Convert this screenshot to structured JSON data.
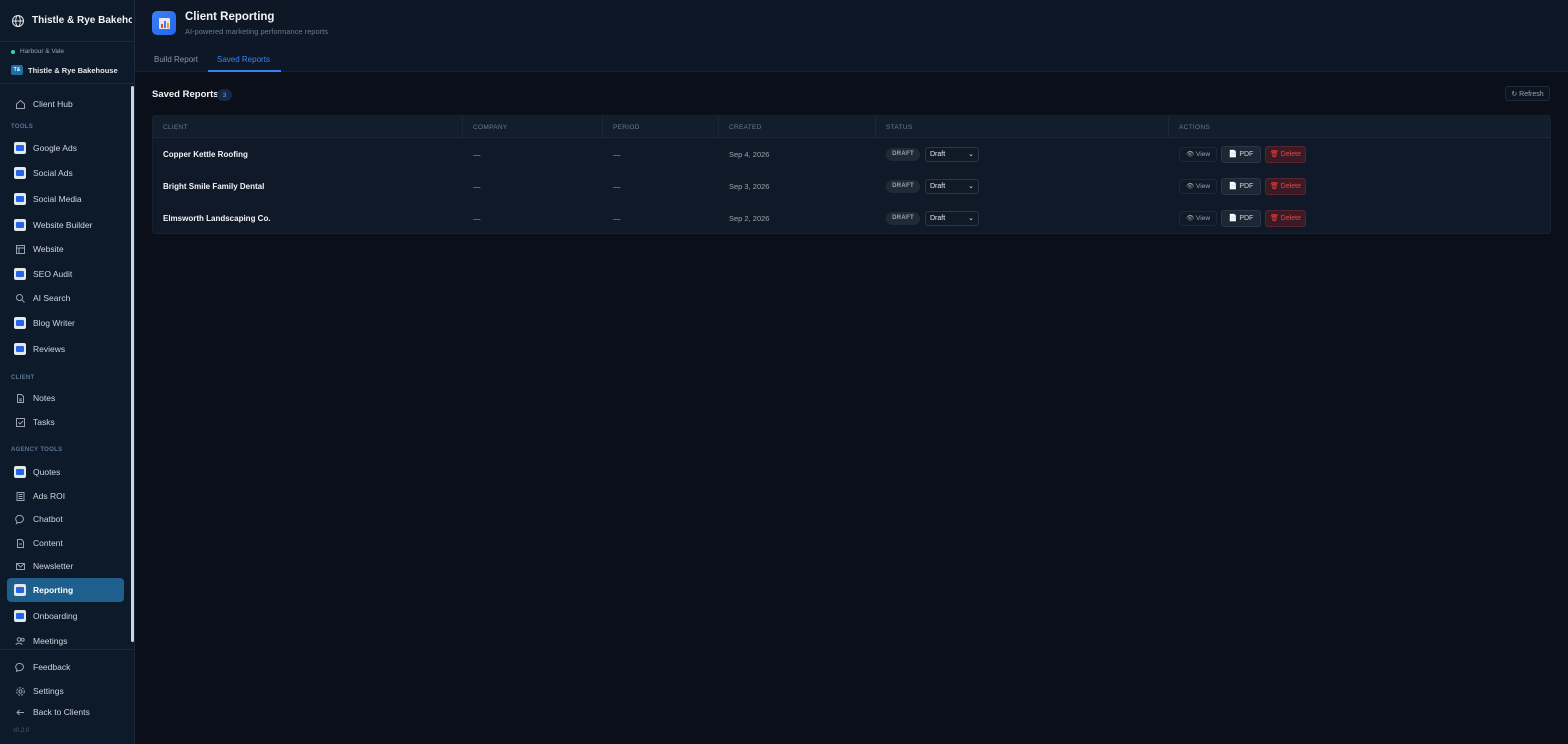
{
  "sidebar": {
    "brand": "Thistle & Rye Bakehouse",
    "agency": "Harbour & Vale",
    "client_initials": "T&",
    "client_name": "Thistle & Rye Bakehouse",
    "client_hub": "Client Hub",
    "sections": {
      "tools": "TOOLS",
      "client": "CLIENT",
      "agency_tools": "AGENCY TOOLS"
    },
    "tools": [
      "Google Ads",
      "Social Ads",
      "Social Media",
      "Website Builder",
      "Website",
      "SEO Audit",
      "AI Search",
      "Blog Writer",
      "Reviews"
    ],
    "client_items": [
      "Notes",
      "Tasks"
    ],
    "agency_items": [
      "Quotes",
      "Ads ROI",
      "Chatbot",
      "Content",
      "Newsletter",
      "Reporting",
      "Onboarding",
      "Meetings"
    ],
    "bottom": [
      "Feedback",
      "Settings",
      "Back to Clients"
    ],
    "version": "v0.2.0"
  },
  "header": {
    "title": "Client Reporting",
    "subtitle": "AI-powered marketing performance reports",
    "tabs": [
      {
        "label": "Build Report",
        "active": false
      },
      {
        "label": "Saved Reports",
        "active": true
      }
    ]
  },
  "main": {
    "title": "Saved Reports",
    "count": "3",
    "refresh_label": "↻ Refresh",
    "columns": [
      "CLIENT",
      "COMPANY",
      "PERIOD",
      "CREATED",
      "STATUS",
      "ACTIONS"
    ],
    "rows": [
      {
        "client": "Copper Kettle Roofing",
        "company": "—",
        "period": "—",
        "created": "Sep 4, 2026",
        "badge": "DRAFT",
        "status": "Draft"
      },
      {
        "client": "Bright Smile Family Dental",
        "company": "—",
        "period": "—",
        "created": "Sep 3, 2026",
        "badge": "DRAFT",
        "status": "Draft"
      },
      {
        "client": "Elmsworth Landscaping Co.",
        "company": "—",
        "period": "—",
        "created": "Sep 2, 2026",
        "badge": "DRAFT",
        "status": "Draft"
      }
    ],
    "actions": {
      "view": "👁 View",
      "pdf": "📄 PDF",
      "delete": "🗑 Delete"
    }
  },
  "colors": {
    "accent": "#3b82f6",
    "active_nav": "#1e5f8e",
    "danger": "#ef4444"
  }
}
